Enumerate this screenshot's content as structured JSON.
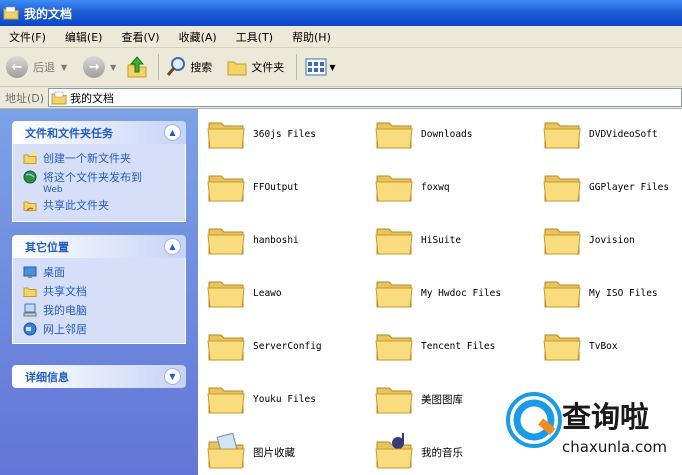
{
  "window": {
    "title": "我的文档"
  },
  "menu": [
    "文件(F)",
    "编辑(E)",
    "查看(V)",
    "收藏(A)",
    "工具(T)",
    "帮助(H)"
  ],
  "toolbar": {
    "back": "后退",
    "search": "搜索",
    "folders": "文件夹"
  },
  "address": {
    "label": "地址(D)",
    "value": "我的文档"
  },
  "tasks": {
    "title": "文件和文件夹任务",
    "items": [
      "创建一个新文件夹",
      "将这个文件夹发布到",
      "Web",
      "共享此文件夹"
    ]
  },
  "places": {
    "title": "其它位置",
    "items": [
      "桌面",
      "共享文档",
      "我的电脑",
      "网上邻居"
    ]
  },
  "details": {
    "title": "详细信息"
  },
  "folders": [
    "360js Files",
    "Downloads",
    "DVDVideoSoft",
    "FFOutput",
    "foxwq",
    "GGPlayer Files",
    "hanboshi",
    "HiSuite",
    "Jovision",
    "Leawo",
    "My Hwdoc Files",
    "My ISO Files",
    "ServerConfig",
    "Tencent Files",
    "TvBox",
    "Youku Files",
    "美图图库",
    "图片收藏",
    "我的音乐"
  ],
  "watermark": {
    "brand": "查询啦",
    "url": "chaxunla.com"
  }
}
